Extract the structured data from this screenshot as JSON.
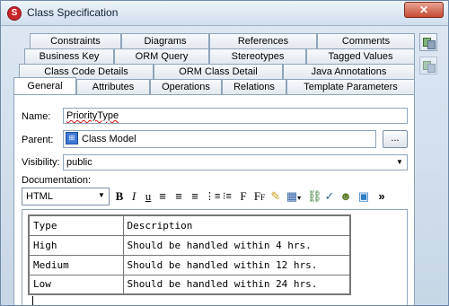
{
  "window": {
    "title": "Class Specification",
    "close_glyph": "✕"
  },
  "tabs": {
    "row1": [
      "Constraints",
      "Diagrams",
      "References",
      "Comments"
    ],
    "row2": [
      "Business Key",
      "ORM Query",
      "Stereotypes",
      "Tagged Values"
    ],
    "row3": [
      "Class Code Details",
      "ORM Class Detail",
      "Java Annotations"
    ],
    "row4": [
      "General",
      "Attributes",
      "Operations",
      "Relations",
      "Template Parameters"
    ],
    "active": "General"
  },
  "form": {
    "name_label": "Name:",
    "name_value": "PriorityType",
    "parent_label": "Parent:",
    "parent_value": "Class Model",
    "parent_browse": "...",
    "visibility_label": "Visibility:",
    "visibility_value": "public",
    "documentation_label": "Documentation:"
  },
  "toolbar": {
    "format_value": "HTML",
    "buttons": [
      "bold-icon",
      "italic-icon",
      "underline-icon",
      "align-left-icon",
      "align-center-icon",
      "align-right-icon",
      "ordered-list-icon",
      "unordered-list-icon",
      "font-icon",
      "font-size-icon",
      "highlight-icon",
      "table-icon",
      "link-icon",
      "spell-check-icon",
      "user-icon",
      "image-icon",
      "more-icon"
    ]
  },
  "documentation_table": {
    "rows": [
      [
        "Type",
        "Description"
      ],
      [
        "High",
        "Should be handled within 4 hrs."
      ],
      [
        "Medium",
        "Should be handled within 12 hrs."
      ],
      [
        "Low",
        "Should be handled within 24 hrs."
      ]
    ]
  },
  "colors": {
    "window_bg": "#c7d6e6",
    "close_button": "#c74a33",
    "tab_border": "#8ea4bb"
  }
}
